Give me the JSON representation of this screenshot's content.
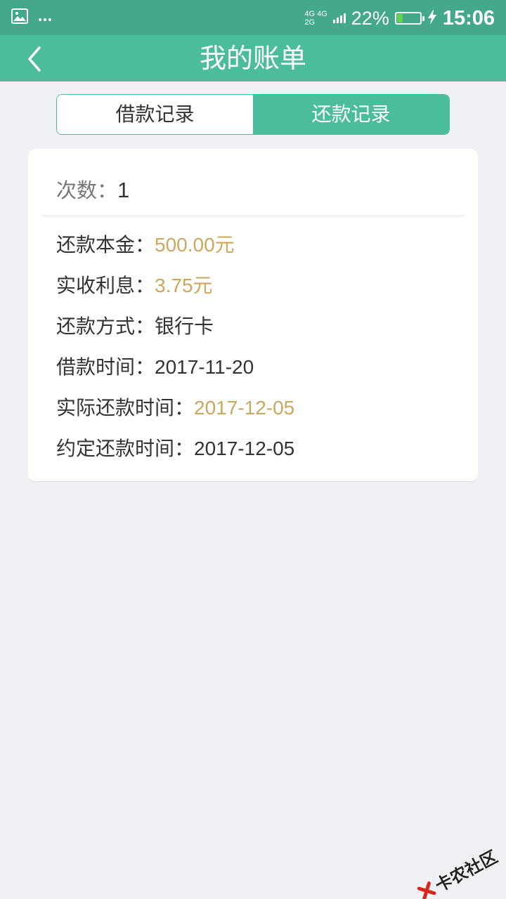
{
  "status_bar": {
    "net_top": "4G 4G",
    "net_bottom": "2G",
    "battery_percent": "22%",
    "battery_level": 0.22,
    "time": "15:06",
    "accent_color": "#44a98a"
  },
  "header": {
    "title": "我的账单",
    "back_icon": "chevron-left-icon",
    "color": "#4bbd9c"
  },
  "tabs": [
    {
      "label": "借款记录",
      "active": false
    },
    {
      "label": "还款记录",
      "active": true
    }
  ],
  "record": {
    "count_label": "次数：",
    "count_value": "1",
    "fields": [
      {
        "label": "还款本金：",
        "value": "500.00元",
        "highlight": true
      },
      {
        "label": "实收利息：",
        "value": "3.75元",
        "highlight": true
      },
      {
        "label": "还款方式：",
        "value": "银行卡",
        "highlight": false
      },
      {
        "label": "借款时间：",
        "value": "2017-11-20",
        "highlight": false
      },
      {
        "label": "实际还款时间：",
        "value": "2017-12-05",
        "highlight": true
      },
      {
        "label": "约定还款时间：",
        "value": "2017-12-05",
        "highlight": false
      }
    ],
    "highlight_color": "#cba75f"
  },
  "watermark": {
    "text": "卡农社区"
  }
}
